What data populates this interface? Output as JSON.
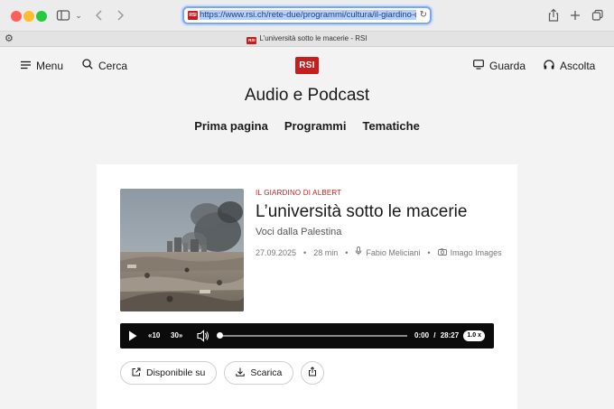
{
  "browser": {
    "url": "https://www.rsi.ch/rete-due/programmi/cultura/il-giardino-di-",
    "favicon_text": "RSI",
    "tab_title": "L’università sotto le macerie - RSI"
  },
  "header": {
    "menu_label": "Menu",
    "search_label": "Cerca",
    "logo_text": "RSI",
    "watch_label": "Guarda",
    "listen_label": "Ascolta"
  },
  "page": {
    "title": "Audio e Podcast",
    "nav": [
      "Prima pagina",
      "Programmi",
      "Tematiche"
    ]
  },
  "episode": {
    "category": "IL GIARDINO DI ALBERT",
    "title": "L’università sotto le macerie",
    "subtitle": "Voci dalla Palestina",
    "date": "27.09.2025",
    "duration": "28 min",
    "author": "Fabio Meliciani",
    "image_credit": "Imago Images",
    "image_icon": "camera-icon",
    "author_icon": "microphone-icon"
  },
  "player": {
    "rewind_label": "10",
    "forward_label": "30",
    "current_time": "0:00",
    "separator": "/",
    "total_time": "28:27",
    "speed": "1.0 x",
    "progress": 0
  },
  "actions": {
    "available_label": "Disponibile su",
    "download_label": "Scarica"
  },
  "colors": {
    "brand_red": "#c31f1f",
    "player_bg": "#0b0b0b",
    "url_focus": "#7aa6ec"
  }
}
